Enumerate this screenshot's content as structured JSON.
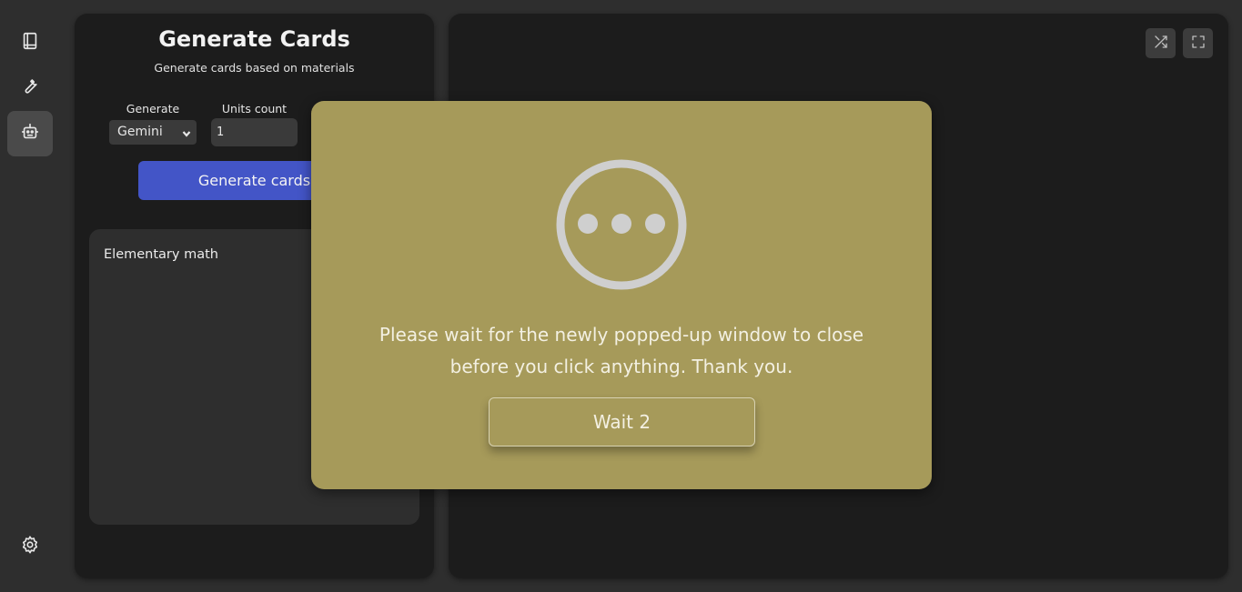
{
  "sidebar": {
    "items": [
      {
        "name": "book-icon",
        "active": false
      },
      {
        "name": "wrench-icon",
        "active": false
      },
      {
        "name": "robot-icon",
        "active": true
      }
    ],
    "settings_icon": "gear-icon"
  },
  "generator": {
    "title": "Generate Cards",
    "subtitle": "Generate cards based on materials",
    "generate_label": "Generate",
    "generate_value": "Gemini",
    "units_label": "Units count",
    "units_value": "1",
    "button_label": "Generate cards",
    "materials": [
      "Elementary math"
    ]
  },
  "viewer": {
    "tools": [
      "shuffle-icon",
      "fullscreen-icon"
    ]
  },
  "modal": {
    "icon": "more-horizontal-circle-icon",
    "message": "Please wait for the newly popped-up window to close before you click anything. Thank you.",
    "wait_button": "Wait 2"
  },
  "colors": {
    "background": "#2e2e2e",
    "panel": "#1c1c1c",
    "accent": "#4355c7",
    "modal": "#a69a5a"
  }
}
